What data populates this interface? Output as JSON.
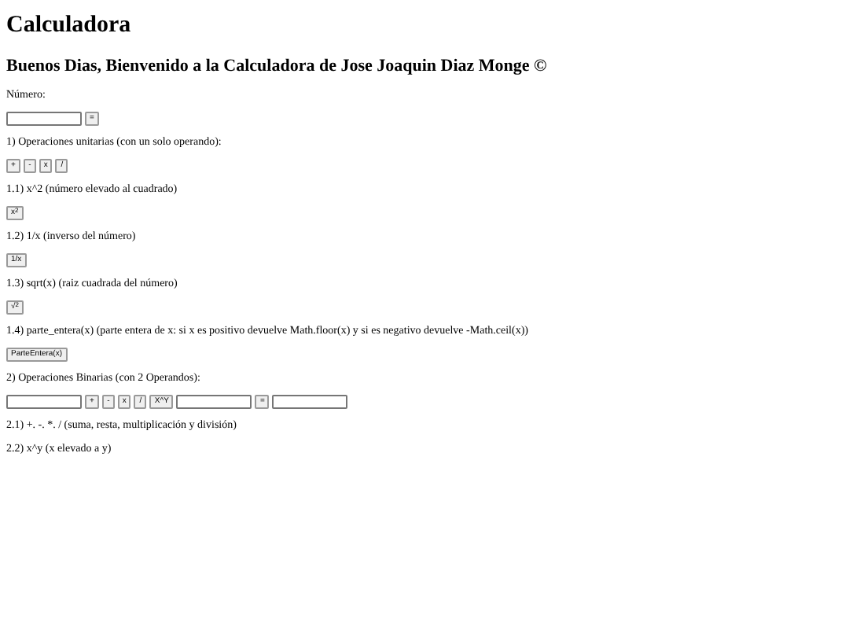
{
  "title": "Calculadora",
  "subtitle": "Buenos Dias, Bienvenido a la Calculadora de Jose Joaquin Diaz Monge ©",
  "blocks": [
    {
      "kind": "text",
      "text": "Número:"
    },
    {
      "kind": "controls",
      "items": [
        {
          "kind": "field"
        },
        {
          "kind": "button",
          "label": "="
        }
      ]
    },
    {
      "kind": "text",
      "text": "1) Operaciones unitarias (con un solo operando):"
    },
    {
      "kind": "controls",
      "items": [
        {
          "kind": "button",
          "label": "+"
        },
        {
          "kind": "button",
          "label": "-"
        },
        {
          "kind": "button",
          "label": "x"
        },
        {
          "kind": "button",
          "label": "/"
        }
      ]
    },
    {
      "kind": "text",
      "text": "1.1) x^2 (número elevado al cuadrado)"
    },
    {
      "kind": "controls",
      "items": [
        {
          "kind": "button",
          "label": "x$^{2}$"
        }
      ]
    },
    {
      "kind": "text",
      "text": "1.2) 1/x (inverso del número)"
    },
    {
      "kind": "controls",
      "items": [
        {
          "kind": "button",
          "label": "1/x"
        }
      ]
    },
    {
      "kind": "text",
      "text": "1.3) sqrt(x) (raiz cuadrada del número)"
    },
    {
      "kind": "controls",
      "items": [
        {
          "kind": "button",
          "label": "√$^{2}$"
        }
      ]
    },
    {
      "kind": "text",
      "text": "1.4) parte_entera(x) (parte entera de x: si x es positivo devuelve Math.floor(x) y si es negativo devuelve -Math.ceil(x))"
    },
    {
      "kind": "controls",
      "items": [
        {
          "kind": "button",
          "label": "ParteEntera(x)"
        }
      ]
    },
    {
      "kind": "text",
      "text": "2) Operaciones Binarias (con 2 Operandos):"
    },
    {
      "kind": "controls",
      "items": [
        {
          "kind": "field"
        },
        {
          "kind": "button",
          "label": "+"
        },
        {
          "kind": "button",
          "label": "-"
        },
        {
          "kind": "button",
          "label": "x"
        },
        {
          "kind": "button",
          "label": "/"
        },
        {
          "kind": "button",
          "label": "X^Y"
        },
        {
          "kind": "field"
        },
        {
          "kind": "button",
          "label": "="
        },
        {
          "kind": "field"
        }
      ]
    },
    {
      "kind": "text",
      "text": "2.1) +. -. *. / (suma, resta, multiplicación y división)"
    },
    {
      "kind": "text",
      "text": "2.2) x^y (x elevado a y)"
    }
  ]
}
